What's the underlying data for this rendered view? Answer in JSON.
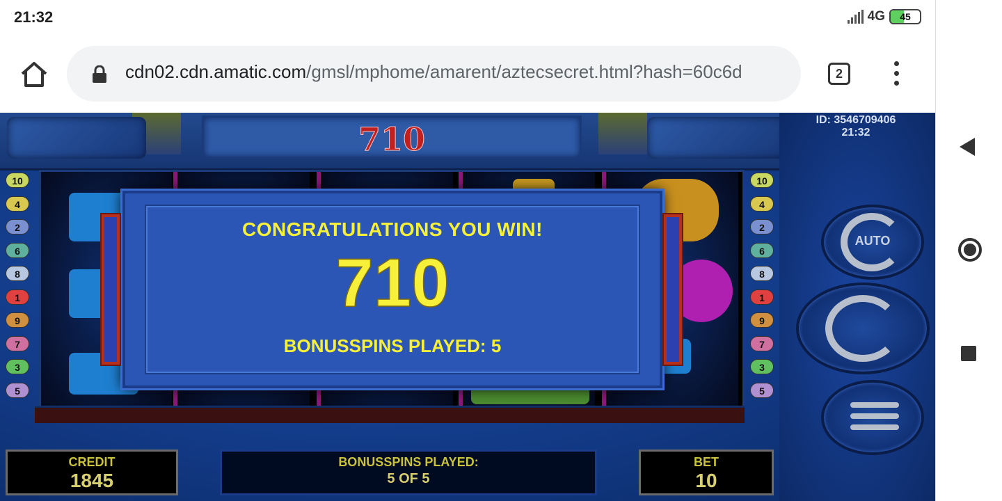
{
  "status_bar": {
    "time": "21:32",
    "network": "4G",
    "battery": "45",
    "battery_level": 0.45
  },
  "browser": {
    "url_host": "cdn02.cdn.amatic.com",
    "url_path": "/gmsl/mphome/amarent/aztecsecret.html?hash=60c6d",
    "tab_count": "2"
  },
  "game": {
    "top_win": "710",
    "machine_id": "ID: 3546709406",
    "machine_time": "21:32",
    "lines_left": [
      "10",
      "4",
      "2",
      "6",
      "8",
      "1",
      "9",
      "7",
      "3",
      "5"
    ],
    "lines_right": [
      "10",
      "4",
      "2",
      "6",
      "8",
      "1",
      "9",
      "7",
      "3",
      "5"
    ],
    "line_colors": [
      "#c8d860",
      "#d8c850",
      "#7a90d0",
      "#60b0a0",
      "#b8c8e0",
      "#e04040",
      "#d09040",
      "#d070a0",
      "#60c060",
      "#b090d0"
    ],
    "auto_label": "AUTO",
    "popup": {
      "congrats": "CONGRATULATIONS YOU WIN!",
      "amount": "710",
      "spins_played": "BONUSSPINS PLAYED: 5"
    },
    "credit": {
      "label": "CREDIT",
      "value": "1845"
    },
    "bonus": {
      "label": "BONUSSPINS PLAYED:",
      "value": "5 OF 5"
    },
    "bet": {
      "label": "BET",
      "value": "10"
    }
  },
  "colors": {
    "accent_yellow": "#f6f03a",
    "win_red": "#c02020"
  }
}
